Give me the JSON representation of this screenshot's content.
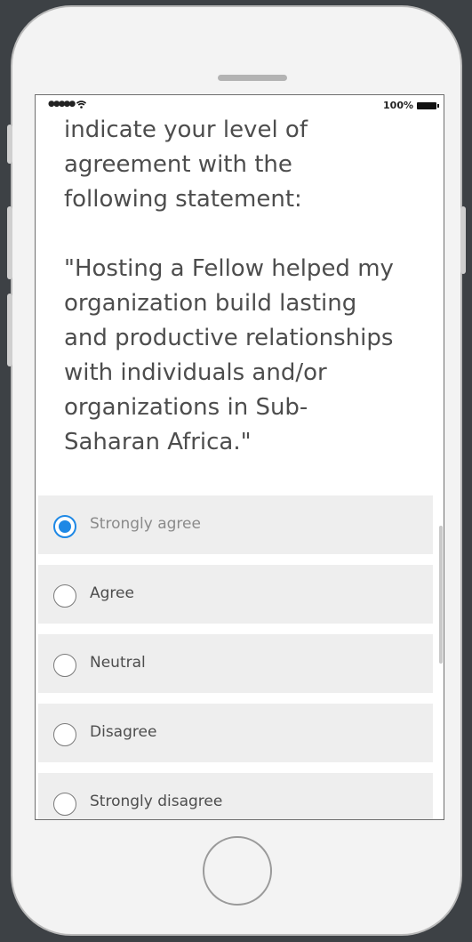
{
  "status_bar": {
    "signal": "●●●●●",
    "battery_text": "100%"
  },
  "question": {
    "intro": "indicate your level of\nagreement with the\nfollowing statement:",
    "statement": "\"Hosting a Fellow helped my\norganization build lasting\nand productive relationships\nwith individuals and/or\norganizations in Sub-\nSaharan Africa.\""
  },
  "options": [
    {
      "label": "Strongly agree",
      "selected": true
    },
    {
      "label": "Agree",
      "selected": false
    },
    {
      "label": "Neutral",
      "selected": false
    },
    {
      "label": "Disagree",
      "selected": false
    },
    {
      "label": "Strongly disagree",
      "selected": false
    }
  ],
  "colors": {
    "accent": "#1e88e5",
    "background": "#3d4145",
    "phone_body": "#f3f3f3",
    "option_bg": "#eeeeee",
    "text": "#4d4d4d"
  }
}
